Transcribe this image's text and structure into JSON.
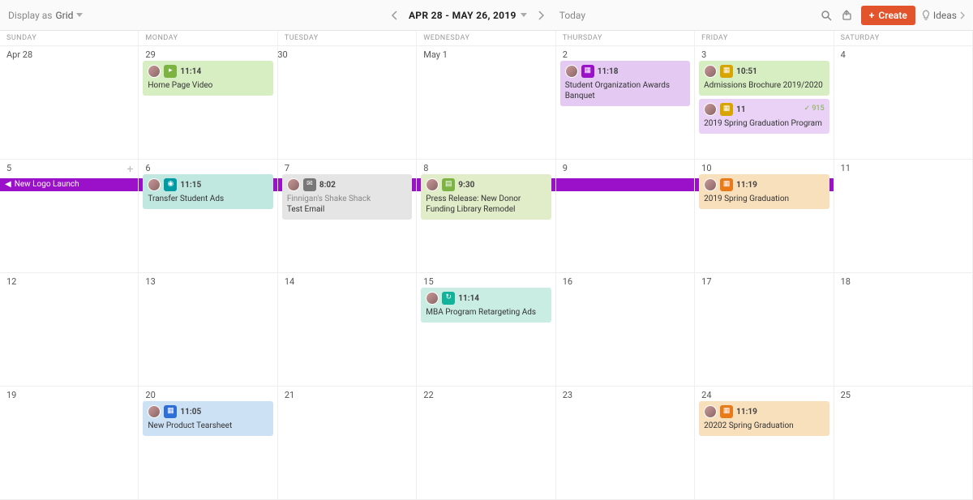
{
  "toolbar": {
    "display_as_label": "Display as",
    "display_as_value": "Grid",
    "date_range": "APR 28 - MAY 26, 2019",
    "today_label": "Today",
    "create_label": "Create",
    "ideas_label": "Ideas"
  },
  "day_headers": [
    "SUNDAY",
    "MONDAY",
    "TUESDAY",
    "WEDNESDAY",
    "THURSDAY",
    "FRIDAY",
    "SATURDAY"
  ],
  "banner": {
    "title": "New Logo Launch"
  },
  "dates": {
    "r0": [
      "Apr 28",
      "29",
      "30",
      "May 1",
      "2",
      "3",
      "4"
    ],
    "r1": [
      "5",
      "6",
      "7",
      "8",
      "9",
      "10",
      "11"
    ],
    "r2": [
      "12",
      "13",
      "14",
      "15",
      "16",
      "17",
      "18"
    ],
    "r3": [
      "19",
      "20",
      "21",
      "22",
      "23",
      "24",
      "25"
    ]
  },
  "events": {
    "home_page_video": {
      "time": "11:14",
      "title": "Home Page Video",
      "badge_color": "#7cb342"
    },
    "student_awards": {
      "time": "11:18",
      "title": "Student Organization Awards Banquet",
      "badge_color": "#9b10c9"
    },
    "admissions_brochure": {
      "time": "10:51",
      "title": "Admissions Brochure 2019/2020",
      "badge_color": "#d8a400"
    },
    "spring_grad_program": {
      "time": "11",
      "title": "2019 Spring Graduation Program",
      "badge_color": "#d8a400",
      "check": "915"
    },
    "transfer_ads": {
      "time": "11:15",
      "title": "Transfer Student Ads",
      "badge_color": "#009aa3"
    },
    "finnigans": {
      "time": "8:02",
      "title_1": "Finnigan's Shake Shack",
      "title_2": "Test Email",
      "badge_color": "#777"
    },
    "press_release": {
      "time": "9:30",
      "title": "Press Release: New Donor Funding Library Remodel",
      "badge_color": "#7cb342"
    },
    "spring_grad_2019": {
      "time": "11:19",
      "title": "2019 Spring Graduation",
      "badge_color": "#e87a1a"
    },
    "mba_retargeting": {
      "time": "11:14",
      "title": "MBA Program Retargeting Ads",
      "badge_color": "#12b39a"
    },
    "new_product_tearsheet": {
      "time": "11:05",
      "title": "New Product Tearsheet",
      "badge_color": "#2e6fd6"
    },
    "spring_grad_20202": {
      "time": "11:19",
      "title": "20202 Spring Graduation",
      "badge_color": "#e87a1a"
    }
  }
}
